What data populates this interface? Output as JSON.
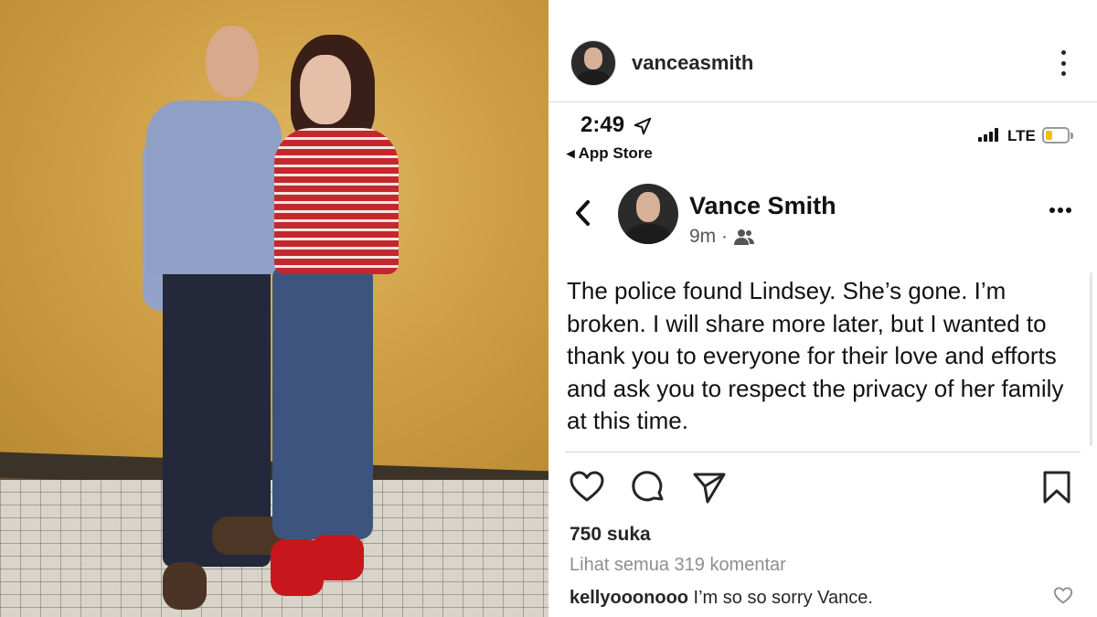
{
  "photo": {
    "description_icon": "couple-photo"
  },
  "post": {
    "username": "vanceasmith",
    "more_icon": "more-vertical-icon"
  },
  "screenshot": {
    "status_time": "2:49",
    "back_label": "◂ App Store",
    "network": "LTE",
    "battery_level": 0.3,
    "battery_color": "#f2c200",
    "author_name": "Vance Smith",
    "time_ago": "9m ·",
    "body_text": "The police found Lindsey. She’s gone. I’m broken.  I will share more later, but I wanted to thank you to everyone for their love and efforts and ask you to respect the privacy of her family at this time."
  },
  "actions": {
    "likes": "750 suka",
    "view_comments": "Lihat semua 319 komentar"
  },
  "comment": {
    "username": "kellyooonooo",
    "text": " I’m so so sorry Vance."
  }
}
